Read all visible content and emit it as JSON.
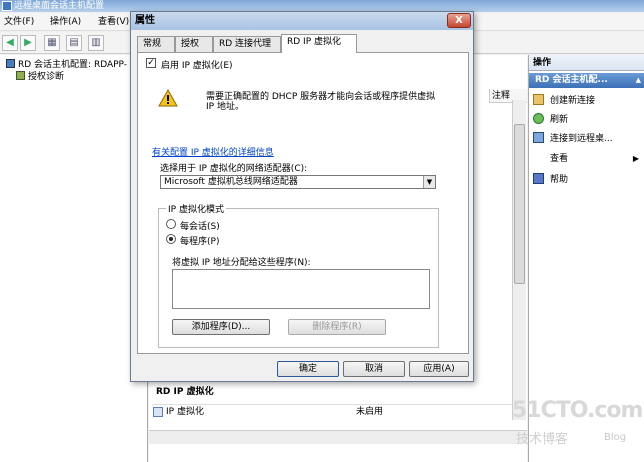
{
  "app": {
    "title": "远程桌面会话主机配置",
    "menu": [
      "文件(F)",
      "操作(A)",
      "查看(V)"
    ]
  },
  "tree": {
    "items": [
      {
        "label": "RD 会话主机配置: RDAPP-"
      },
      {
        "label": "授权诊断"
      }
    ]
  },
  "center": {
    "column_header": "注释",
    "section_title": "RD IP 虚拟化",
    "row": {
      "name": "IP 虚拟化",
      "value": "未启用"
    }
  },
  "actions": {
    "header": "操作",
    "subheader": "RD 会话主机配...",
    "items": [
      {
        "label": "创建新连接",
        "icon": "new-connection-icon"
      },
      {
        "label": "刷新",
        "icon": "refresh-icon"
      },
      {
        "label": "连接到远程桌...",
        "icon": "connect-remote-icon"
      },
      {
        "label": "查看",
        "icon": "view-icon"
      },
      {
        "label": "帮助",
        "icon": "help-icon"
      }
    ]
  },
  "dialog": {
    "title": "属性",
    "close_label": "X",
    "tabs": [
      "常规",
      "授权",
      "RD 连接代理",
      "RD IP 虚拟化"
    ],
    "active_tab": 3,
    "enable_label": "启用 IP 虚拟化(E)",
    "enable_checked": true,
    "warning_line1": "需要正确配置的 DHCP 服务器才能向会话或程序提供虚拟",
    "warning_line2": "IP 地址。",
    "link": "有关配置 IP 虚拟化的详细信息",
    "adapter_label": "选择用于 IP 虚拟化的网络适配器(C):",
    "adapter_value": "Microsoft 虚拟机总线网络适配器",
    "mode_legend": "IP 虚拟化模式",
    "mode_per_session": "每会话(S)",
    "mode_per_program": "每程序(P)",
    "mode_selected": "per_program",
    "assign_label": "将虚拟 IP 地址分配给这些程序(N):",
    "add_program": "添加程序(D)...",
    "delete_program": "删除程序(R)",
    "ok": "确定",
    "cancel": "取消",
    "apply": "应用(A)"
  },
  "watermark": {
    "big": "51CTO.com",
    "small": "技术博客",
    "blog": "Blog"
  }
}
